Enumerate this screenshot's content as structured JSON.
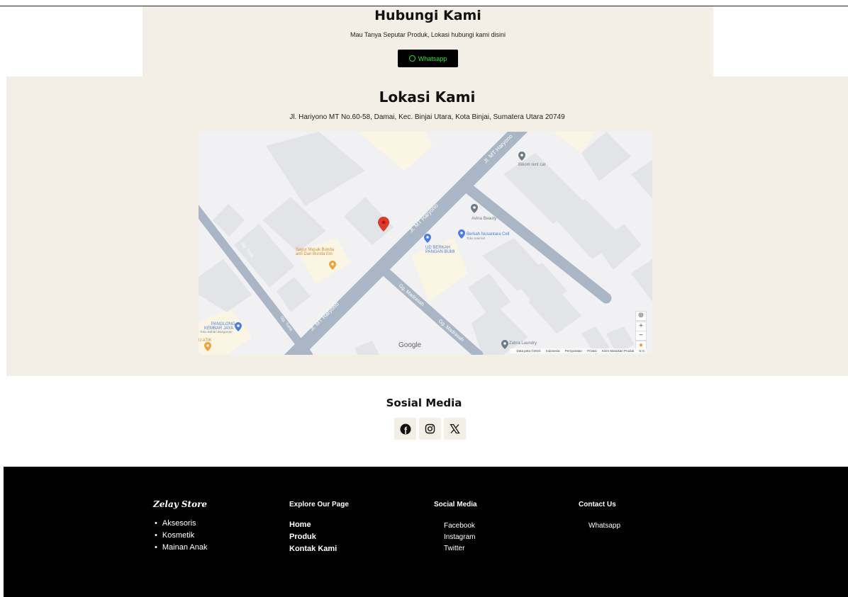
{
  "contact": {
    "title": "Hubungi Kami",
    "subtitle": "Mau Tanya Seputar Produk, Lokasi hubungi kami disini",
    "button_label": "Whatsapp",
    "button_color": "#2fe62f"
  },
  "location": {
    "title": "Lokasi Kami",
    "address": "Jl. Hariyono MT No.60-58, Damai, Kec. Binjai Utara, Kota Binjai, Sumatera Utara 20749",
    "map": {
      "streets": [
        "Jl. MT Haryono",
        "Jl. MT Haryono",
        "Jl. MT Haryono",
        "Gg. Madrasah",
        "Gg. Madrasah",
        "Gg. Tuna",
        "Gg. Tuna"
      ],
      "places": [
        "Bikom rent car",
        "Avina Beauty",
        "Berkah Nusantara Cell",
        "Toko Internet",
        "UD BERKAH",
        "PANGAN BUMI",
        "Sayur Masak Bunda",
        "ami Dan Bunda Eni",
        "PANGLONG",
        "KEMBAR JAYA",
        "Toko Bahan Bangunan",
        "U ATIK",
        "Zahra Laundry"
      ],
      "logo": "Google",
      "footer": [
        "Data peta ©2024",
        "Indonesia",
        "Persyaratan",
        "Privasi",
        "Kirim Masukan Produk",
        "5 m"
      ],
      "controls": [
        "+",
        "−"
      ]
    }
  },
  "social": {
    "title": "Sosial Media",
    "icons": [
      "facebook-icon",
      "instagram-icon",
      "x-icon"
    ]
  },
  "footer": {
    "brand": "Zelay Store",
    "categories": [
      "Aksesoris",
      "Kosmetik",
      "Mainan Anak"
    ],
    "explore_title": "Explore Our Page",
    "explore_links": [
      "Home",
      "Produk",
      "Kontak Kami"
    ],
    "social_title": "Social Media",
    "social_links": [
      "Facebook",
      "Instagram",
      "Twitter"
    ],
    "contact_title": "Contact Us",
    "contact_links": [
      "Whatsapp"
    ]
  }
}
